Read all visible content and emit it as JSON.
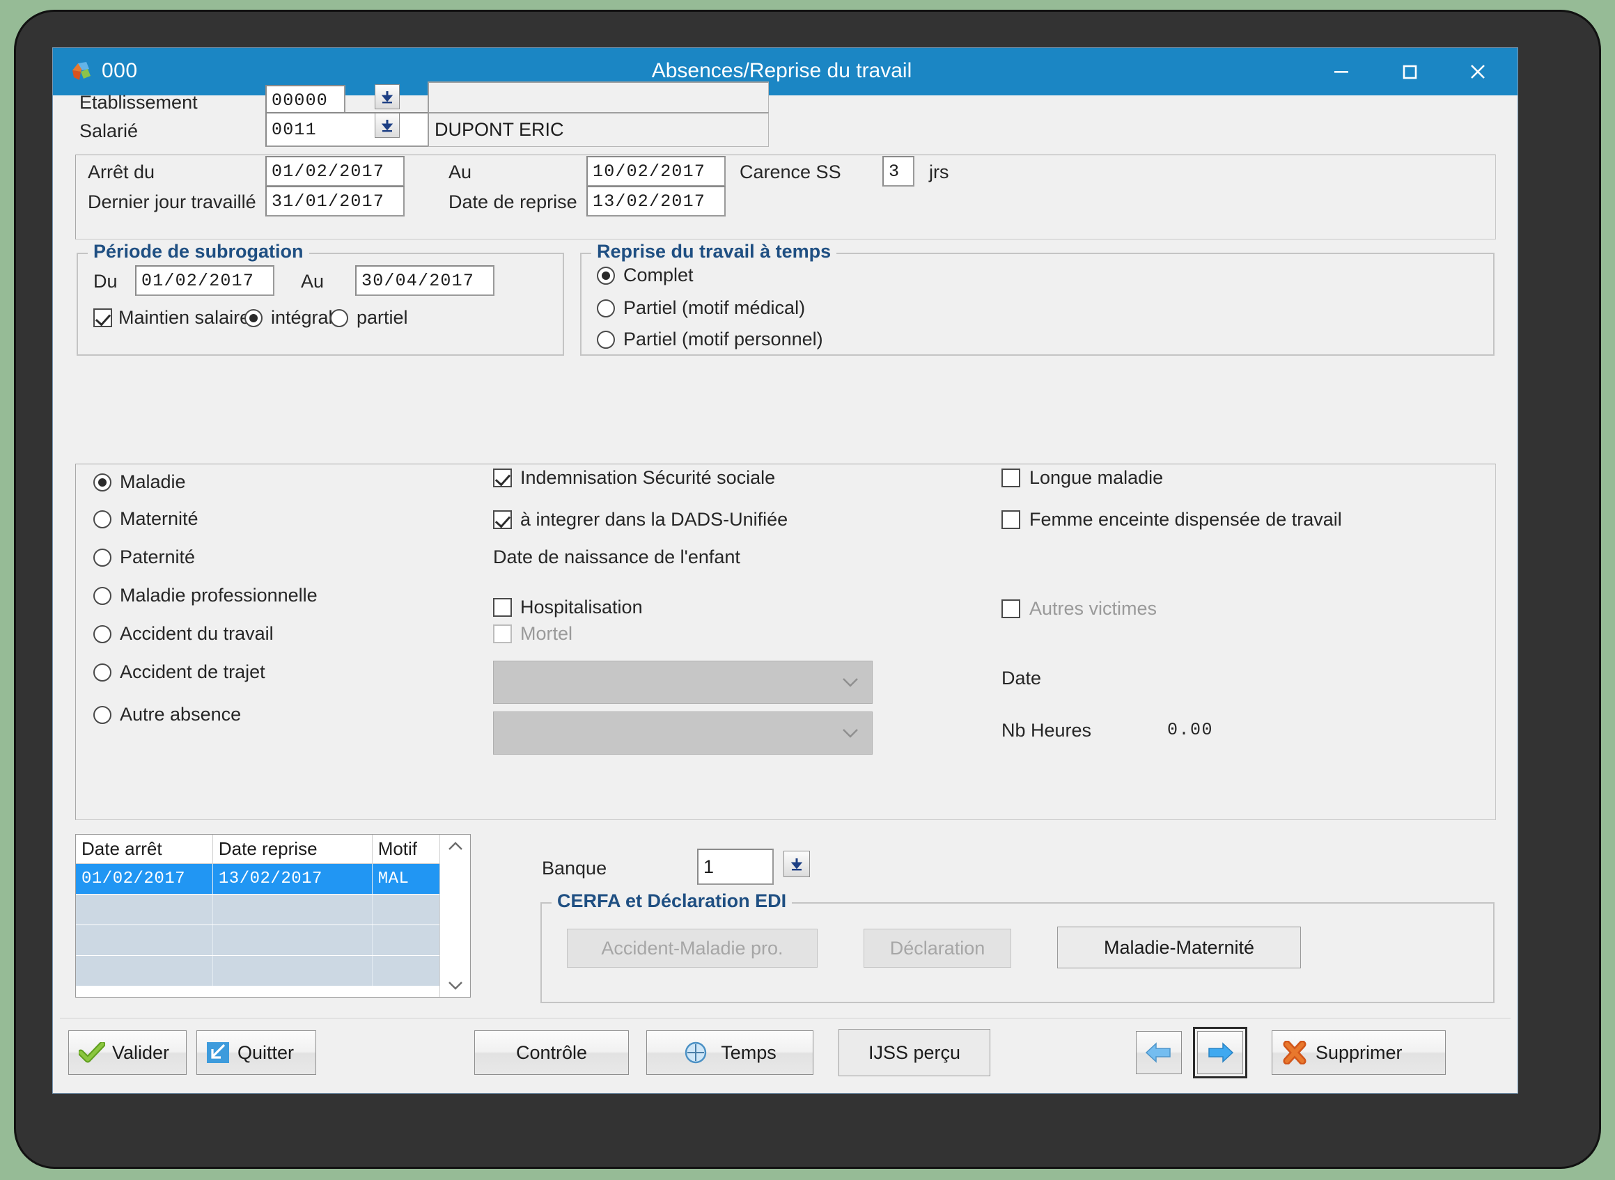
{
  "window": {
    "id_label": "000",
    "title": "Absences/Reprise du travail",
    "app_icon": "puzzle-icon",
    "minimize_label": "–",
    "maximize_label": "□",
    "close_label": "✕",
    "accent_color": "#1b86c4"
  },
  "header": {
    "etablissement_label": "Etablissement",
    "etablissement_value": "00000",
    "etablissement_name": "",
    "salarie_label": "Salarié",
    "salarie_value": "0011",
    "salarie_name": "DUPONT ERIC"
  },
  "arret": {
    "arret_du_label": "Arrêt du",
    "arret_du_value": "01/02/2017",
    "au_label": "Au",
    "au_value": "10/02/2017",
    "carence_label": "Carence SS",
    "carence_value": "3",
    "carence_unit": "jrs",
    "dernier_jour_label": "Dernier jour travaillé",
    "dernier_jour_value": "31/01/2017",
    "date_reprise_label": "Date de reprise",
    "date_reprise_value": "13/02/2017"
  },
  "subrogation": {
    "legend": "Période de subrogation",
    "du_label": "Du",
    "du_value": "01/02/2017",
    "au_label": "Au",
    "au_value": "30/04/2017",
    "maintien_label": "Maintien salaire",
    "maintien_checked": true,
    "integral_label": "intégral",
    "partiel_label": "partiel",
    "selected": "intégral"
  },
  "reprise": {
    "legend": "Reprise du travail à temps",
    "options": [
      {
        "label": "Complet",
        "selected": true
      },
      {
        "label": "Partiel (motif médical)",
        "selected": false
      },
      {
        "label": "Partiel (motif personnel)",
        "selected": false
      }
    ]
  },
  "motifs": {
    "options": [
      {
        "label": "Maladie",
        "selected": true
      },
      {
        "label": "Maternité",
        "selected": false
      },
      {
        "label": "Paternité",
        "selected": false
      },
      {
        "label": "Maladie professionnelle",
        "selected": false
      },
      {
        "label": "Accident du travail",
        "selected": false
      },
      {
        "label": "Accident de trajet",
        "selected": false
      },
      {
        "label": "Autre absence",
        "selected": false
      }
    ]
  },
  "middle_col": {
    "indemnisation_label": "Indemnisation Sécurité sociale",
    "indemnisation_checked": true,
    "dads_label": "à integrer dans la DADS-Unifiée",
    "dads_checked": true,
    "naissance_label": "Date de naissance de l'enfant",
    "hospitalisation_label": "Hospitalisation",
    "hospitalisation_checked": false,
    "mortel_label": "Mortel",
    "mortel_checked": false,
    "mortel_disabled": true,
    "combo1_value": "",
    "combo2_value": ""
  },
  "right_col": {
    "longue_maladie_label": "Longue maladie",
    "longue_maladie_checked": false,
    "femme_enceinte_label": "Femme enceinte dispensée de travail",
    "femme_enceinte_checked": false,
    "autres_victimes_label": "Autres victimes",
    "autres_victimes_checked": false,
    "autres_victimes_disabled": true,
    "date_label": "Date",
    "date_value": "",
    "nb_heures_label": "Nb Heures",
    "nb_heures_value": "0.00"
  },
  "grid": {
    "columns": [
      "Date arrêt",
      "Date reprise",
      "Motif"
    ],
    "rows": [
      {
        "cells": [
          "01/02/2017",
          "13/02/2017",
          "MAL"
        ],
        "selected": true
      },
      {
        "cells": [
          "",
          "",
          ""
        ],
        "selected": false
      },
      {
        "cells": [
          "",
          "",
          ""
        ],
        "selected": false
      },
      {
        "cells": [
          "",
          "",
          ""
        ],
        "selected": false
      }
    ],
    "scroll_up_icon": "chevron-up-icon",
    "scroll_down_icon": "chevron-down-icon"
  },
  "banque": {
    "label": "Banque",
    "value": "1",
    "dropdown_icon": "down-arrow-icon"
  },
  "cerfa": {
    "legend": "CERFA et Déclaration EDI",
    "buttons": [
      {
        "label": "Accident-Maladie pro.",
        "disabled": true
      },
      {
        "label": "Déclaration",
        "disabled": true
      },
      {
        "label": "Maladie-Maternité",
        "disabled": false
      }
    ]
  },
  "toolbar": {
    "valider_label": "Valider",
    "valider_icon": "green-check-icon",
    "quitter_label": "Quitter",
    "quitter_icon": "exit-arrow-icon",
    "controle_label": "Contrôle",
    "temps_label": "Temps",
    "temps_icon": "clock-icon",
    "ijss_label": "IJSS perçu",
    "prev_icon": "left-arrow-icon",
    "next_icon": "right-arrow-icon",
    "supprimer_label": "Supprimer",
    "supprimer_icon": "red-x-icon"
  }
}
